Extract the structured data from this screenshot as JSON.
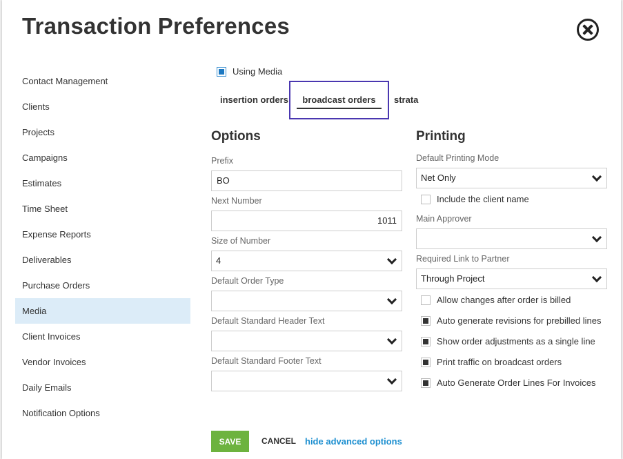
{
  "dialog": {
    "title": "Transaction Preferences",
    "close_icon": "close-circle-icon"
  },
  "sidebar": {
    "items": [
      {
        "label": "Contact Management"
      },
      {
        "label": "Clients"
      },
      {
        "label": "Projects"
      },
      {
        "label": "Campaigns"
      },
      {
        "label": "Estimates"
      },
      {
        "label": "Time Sheet"
      },
      {
        "label": "Expense Reports"
      },
      {
        "label": "Deliverables"
      },
      {
        "label": "Purchase Orders"
      },
      {
        "label": "Media",
        "active": true
      },
      {
        "label": "Client Invoices"
      },
      {
        "label": "Vendor Invoices"
      },
      {
        "label": "Daily Emails"
      },
      {
        "label": "Notification Options"
      }
    ],
    "active_color": "#dcecf8"
  },
  "using_media": {
    "label": "Using Media",
    "checked": true
  },
  "tabs": {
    "insertion": "insertion orders",
    "broadcast": "broadcast orders",
    "strata": "strata",
    "selected": "broadcast orders",
    "highlight_color": "#4a37b0"
  },
  "options": {
    "title": "Options",
    "prefix": {
      "label": "Prefix",
      "value": "BO"
    },
    "next_number": {
      "label": "Next Number",
      "value": "1011"
    },
    "size_of_number": {
      "label": "Size of Number",
      "value": "4"
    },
    "default_order_type": {
      "label": "Default Order Type",
      "value": ""
    },
    "header_text": {
      "label": "Default Standard Header Text",
      "value": ""
    },
    "footer_text": {
      "label": "Default Standard Footer Text",
      "value": ""
    }
  },
  "printing": {
    "title": "Printing",
    "mode": {
      "label": "Default Printing Mode",
      "value": "Net Only"
    },
    "include_client": {
      "label": "Include the client name",
      "checked": false
    },
    "approver": {
      "label": "Main Approver",
      "value": ""
    },
    "link_partner": {
      "label": "Required Link to Partner",
      "value": "Through Project"
    },
    "checks": [
      {
        "label": "Allow changes after order is billed",
        "checked": false
      },
      {
        "label": "Auto generate revisions for prebilled lines",
        "checked": true
      },
      {
        "label": "Show order adjustments as a single line",
        "checked": true
      },
      {
        "label": "Print traffic on broadcast orders",
        "checked": true
      },
      {
        "label": "Auto Generate Order Lines For Invoices",
        "checked": true
      }
    ]
  },
  "actions": {
    "save": "SAVE",
    "cancel": "CANCEL",
    "advanced": "hide advanced options",
    "save_color": "#6db33f",
    "link_color": "#1d8fd0"
  }
}
